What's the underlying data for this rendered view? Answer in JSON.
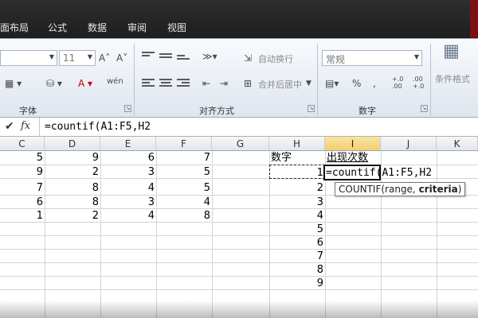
{
  "ribbon_tabs": [
    "面布局",
    "公式",
    "数据",
    "审阅",
    "视图"
  ],
  "font_group": {
    "label": "字体",
    "font_size": "11",
    "grow_icon": "A˄",
    "shrink_icon": "A˅",
    "phonetic_icon": "wén"
  },
  "alignment_group": {
    "label": "对齐方式",
    "wrap_text": "自动换行",
    "merge_center": "合并后居中"
  },
  "number_group": {
    "label": "数字",
    "format": "常规",
    "percent": "%",
    "comma": ",",
    "inc_decimal": "+.0 .00",
    "dec_decimal": ".00 +.0"
  },
  "styles_group": {
    "conditional_format": "条件格式"
  },
  "formula_bar": {
    "check": "✔",
    "fx": "fx",
    "formula": "=countif(A1:F5,H2"
  },
  "columns": [
    "C",
    "D",
    "E",
    "F",
    "G",
    "H",
    "I",
    "J",
    "K"
  ],
  "active_column": "I",
  "rows": [
    {
      "C": "5",
      "D": "9",
      "E": "6",
      "F": "7"
    },
    {
      "C": "9",
      "D": "2",
      "E": "3",
      "F": "5"
    },
    {
      "C": "7",
      "D": "8",
      "E": "4",
      "F": "5"
    },
    {
      "C": "6",
      "D": "8",
      "E": "3",
      "F": "4"
    },
    {
      "C": "1",
      "D": "2",
      "E": "4",
      "F": "8"
    }
  ],
  "h_header": "数字",
  "i_header": "出现次数",
  "h_values": [
    "1",
    "2",
    "3",
    "4",
    "5",
    "6",
    "7",
    "8",
    "9"
  ],
  "active_cell_text": "=countif(A1:F5,H2",
  "tooltip": {
    "fn": "COUNTIF(range, ",
    "bold_arg": "criteria",
    "close": ")"
  },
  "colors": {
    "tab_bar": "#1e1e1e",
    "ribbon": "#dfe6ef",
    "active_header": "#f3cf6e",
    "gridline": "#d4d4d4"
  }
}
